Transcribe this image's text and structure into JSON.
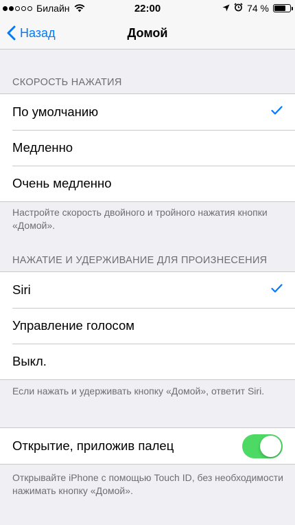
{
  "status_bar": {
    "carrier": "Билайн",
    "time": "22:00",
    "battery_text": "74 %",
    "battery_level": 0.74
  },
  "nav": {
    "back_label": "Назад",
    "title": "Домой"
  },
  "click_speed": {
    "header": "СКОРОСТЬ НАЖАТИЯ",
    "items": [
      {
        "label": "По умолчанию",
        "checked": true
      },
      {
        "label": "Медленно",
        "checked": false
      },
      {
        "label": "Очень медленно",
        "checked": false
      }
    ],
    "footer": "Настройте скорость двойного и тройного нажатия кнопки «Домой»."
  },
  "press_hold": {
    "header": "НАЖАТИЕ И УДЕРЖИВАНИЕ ДЛЯ ПРОИЗНЕСЕНИЯ",
    "items": [
      {
        "label": "Siri",
        "checked": true
      },
      {
        "label": "Управление голосом",
        "checked": false
      },
      {
        "label": "Выкл.",
        "checked": false
      }
    ],
    "footer": "Если нажать и удерживать кнопку «Домой», ответит Siri."
  },
  "rest_finger": {
    "label": "Открытие, приложив палец",
    "enabled": true,
    "footer": "Открывайте iPhone с помощью Touch ID, без необходимости нажимать кнопку «Домой»."
  },
  "colors": {
    "accent": "#007aff",
    "toggle_on": "#4cd964",
    "background": "#efeff4"
  }
}
